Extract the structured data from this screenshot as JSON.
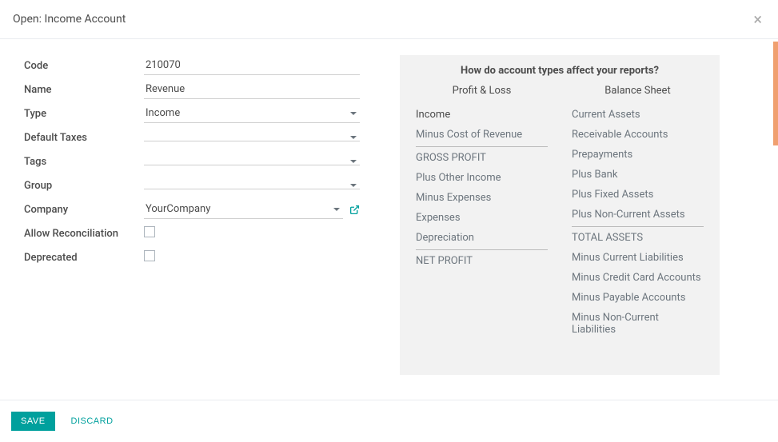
{
  "header": {
    "title": "Open: Income Account"
  },
  "form": {
    "labels": {
      "code": "Code",
      "name": "Name",
      "type": "Type",
      "default_taxes": "Default Taxes",
      "tags": "Tags",
      "group": "Group",
      "company": "Company",
      "allow_reconciliation": "Allow Reconciliation",
      "deprecated": "Deprecated"
    },
    "values": {
      "code": "210070",
      "name": "Revenue",
      "type": "Income",
      "default_taxes": "",
      "tags": "",
      "group": "",
      "company": "YourCompany",
      "allow_reconciliation": false,
      "deprecated": false
    }
  },
  "info": {
    "title": "How do account types affect your reports?",
    "profit_loss": {
      "header": "Profit & Loss",
      "lines": [
        "Income",
        "Minus Cost of Revenue",
        "GROSS PROFIT",
        "Plus Other Income",
        "Minus Expenses",
        "Expenses",
        "Depreciation",
        "NET PROFIT"
      ]
    },
    "balance_sheet": {
      "header": "Balance Sheet",
      "lines": [
        "Current Assets",
        "Receivable Accounts",
        "Prepayments",
        "Plus Bank",
        "Plus Fixed Assets",
        "Plus Non-Current Assets",
        "TOTAL ASSETS",
        "Minus Current Liabilities",
        "Minus Credit Card Accounts",
        "Minus Payable Accounts",
        "Minus Non-Current Liabilities"
      ]
    }
  },
  "footer": {
    "save": "Save",
    "discard": "Discard"
  }
}
